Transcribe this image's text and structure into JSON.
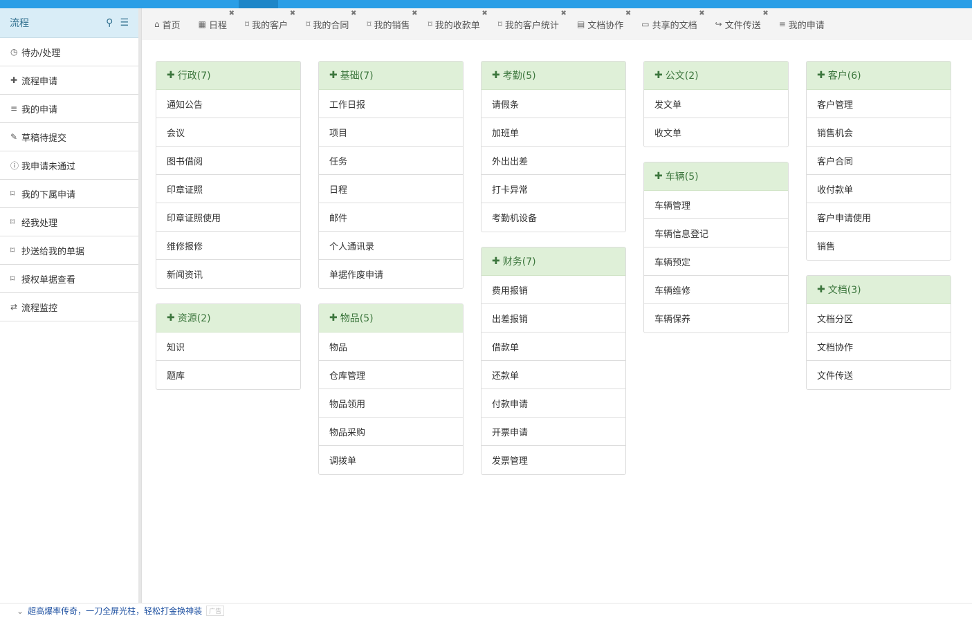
{
  "sidebar": {
    "title": "流程",
    "items": [
      {
        "icon": "clock-icon",
        "glyph": "◷",
        "label": "待办/处理"
      },
      {
        "icon": "plus-icon",
        "glyph": "✚",
        "label": "流程申请"
      },
      {
        "icon": "list-icon",
        "glyph": "≡",
        "label": "我的申请"
      },
      {
        "icon": "edit-icon",
        "glyph": "✎",
        "label": "草稿待提交"
      },
      {
        "icon": "info-icon",
        "glyph": "ⓘ",
        "label": "我申请未通过"
      },
      {
        "icon": "bookmark-icon",
        "glyph": "⌑",
        "label": "我的下属申请"
      },
      {
        "icon": "bookmark-icon",
        "glyph": "⌑",
        "label": "经我处理"
      },
      {
        "icon": "bookmark-icon",
        "glyph": "⌑",
        "label": "抄送给我的单据"
      },
      {
        "icon": "bookmark-icon",
        "glyph": "⌑",
        "label": "授权单据查看"
      },
      {
        "icon": "retweet-icon",
        "glyph": "⇄",
        "label": "流程监控"
      }
    ]
  },
  "tabs": [
    {
      "icon": "home-icon",
      "glyph": "⌂",
      "label": "首页",
      "closable": false
    },
    {
      "icon": "calendar-icon",
      "glyph": "▦",
      "label": "日程",
      "closable": true
    },
    {
      "icon": "bookmark-icon",
      "glyph": "⌑",
      "label": "我的客户",
      "closable": true
    },
    {
      "icon": "bookmark-icon",
      "glyph": "⌑",
      "label": "我的合同",
      "closable": true
    },
    {
      "icon": "bookmark-icon",
      "glyph": "⌑",
      "label": "我的销售",
      "closable": true
    },
    {
      "icon": "bookmark-icon",
      "glyph": "⌑",
      "label": "我的收款单",
      "closable": true
    },
    {
      "icon": "bookmark-icon",
      "glyph": "⌑",
      "label": "我的客户统计",
      "closable": true
    },
    {
      "icon": "file-icon",
      "glyph": "▤",
      "label": "文档协作",
      "closable": true
    },
    {
      "icon": "folder-open-icon",
      "glyph": "▭",
      "label": "共享的文档",
      "closable": true
    },
    {
      "icon": "share-icon",
      "glyph": "↪",
      "label": "文件传送",
      "closable": true
    },
    {
      "icon": "list-icon",
      "glyph": "≡",
      "label": "我的申请",
      "closable": false
    }
  ],
  "columns": [
    [
      {
        "title": "行政(7)",
        "items": [
          "通知公告",
          "会议",
          "图书借阅",
          "印章证照",
          "印章证照使用",
          "维修报修",
          "新闻资讯"
        ]
      },
      {
        "title": "资源(2)",
        "items": [
          "知识",
          "题库"
        ]
      }
    ],
    [
      {
        "title": "基础(7)",
        "items": [
          "工作日报",
          "项目",
          "任务",
          "日程",
          "邮件",
          "个人通讯录",
          "单据作废申请"
        ]
      },
      {
        "title": "物品(5)",
        "items": [
          "物品",
          "仓库管理",
          "物品领用",
          "物品采购",
          "调拨单"
        ]
      }
    ],
    [
      {
        "title": "考勤(5)",
        "items": [
          "请假条",
          "加班单",
          "外出出差",
          "打卡异常",
          "考勤机设备"
        ]
      },
      {
        "title": "财务(7)",
        "items": [
          "费用报销",
          "出差报销",
          "借款单",
          "还款单",
          "付款申请",
          "开票申请",
          "发票管理"
        ]
      }
    ],
    [
      {
        "title": "公文(2)",
        "items": [
          "发文单",
          "收文单"
        ]
      },
      {
        "title": "车辆(5)",
        "items": [
          "车辆管理",
          "车辆信息登记",
          "车辆预定",
          "车辆维修",
          "车辆保养"
        ]
      }
    ],
    [
      {
        "title": "客户(6)",
        "items": [
          "客户管理",
          "销售机会",
          "客户合同",
          "收付款单",
          "客户申请使用",
          "销售"
        ]
      },
      {
        "title": "文档(3)",
        "items": [
          "文档分区",
          "文档协作",
          "文件传送"
        ]
      }
    ]
  ],
  "footer": {
    "text": "超高爆率传奇，一刀全屏光柱，轻松打金换神装",
    "ad": "广告"
  }
}
